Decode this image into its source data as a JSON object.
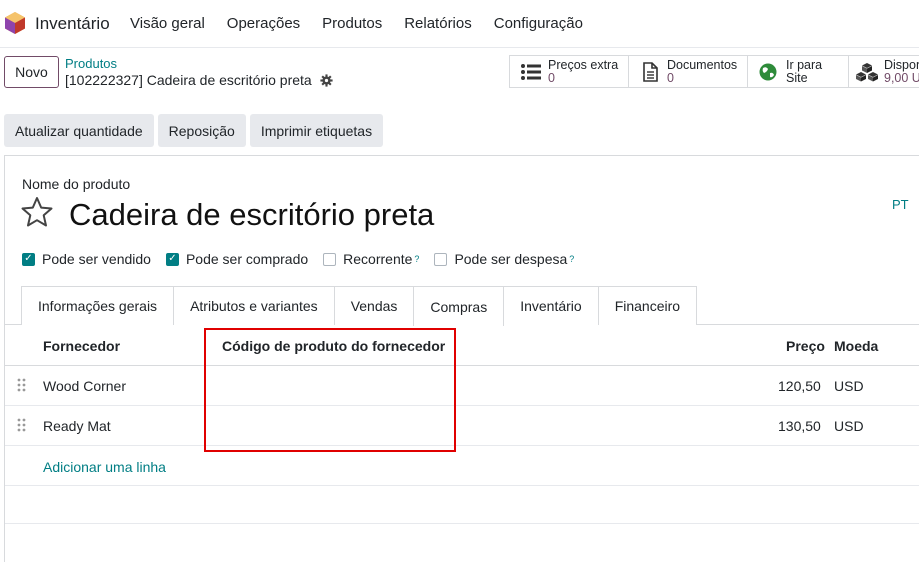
{
  "app": {
    "name": "Inventário",
    "logo_icon": "odoo-app-logo-icon"
  },
  "menu": [
    "Visão geral",
    "Operações",
    "Produtos",
    "Relatórios",
    "Configuração"
  ],
  "control": {
    "new_label": "Novo",
    "breadcrumb_parent": "Produtos",
    "breadcrumb_current": "[102222327] Cadeira de escritório preta"
  },
  "smart_buttons": [
    {
      "label": "Preços extra",
      "value": "0",
      "icon": "list-icon"
    },
    {
      "label": "Documentos",
      "value": "0",
      "icon": "document-icon"
    },
    {
      "label": "Ir para",
      "value": "Site",
      "icon": "globe-icon"
    },
    {
      "label": "Dispon",
      "value": "9,00 U",
      "icon": "cubes-icon"
    }
  ],
  "actions": [
    "Atualizar quantidade",
    "Reposição",
    "Imprimir etiquetas"
  ],
  "form": {
    "name_label": "Nome do produto",
    "product_name": "Cadeira de escritório preta",
    "lang": "PT",
    "checkboxes": [
      {
        "label": "Pode ser vendido",
        "checked": true,
        "help": ""
      },
      {
        "label": "Pode ser comprado",
        "checked": true,
        "help": ""
      },
      {
        "label": "Recorrente",
        "checked": false,
        "help": "?"
      },
      {
        "label": "Pode ser despesa",
        "checked": false,
        "help": "?"
      }
    ],
    "tabs": [
      "Informações gerais",
      "Atributos e variantes",
      "Vendas",
      "Compras",
      "Inventário",
      "Financeiro"
    ],
    "active_tab": "Compras"
  },
  "table": {
    "columns": [
      "Fornecedor",
      "Código de produto do fornecedor",
      "Preço",
      "Moeda"
    ],
    "rows": [
      {
        "vendor": "Wood Corner",
        "code": "",
        "price": "120,50",
        "currency": "USD"
      },
      {
        "vendor": "Ready Mat",
        "code": "",
        "price": "130,50",
        "currency": "USD"
      }
    ],
    "add_line": "Adicionar uma linha"
  },
  "colors": {
    "primary": "#714b67",
    "accent": "#017e84",
    "highlight": "#e00000"
  }
}
